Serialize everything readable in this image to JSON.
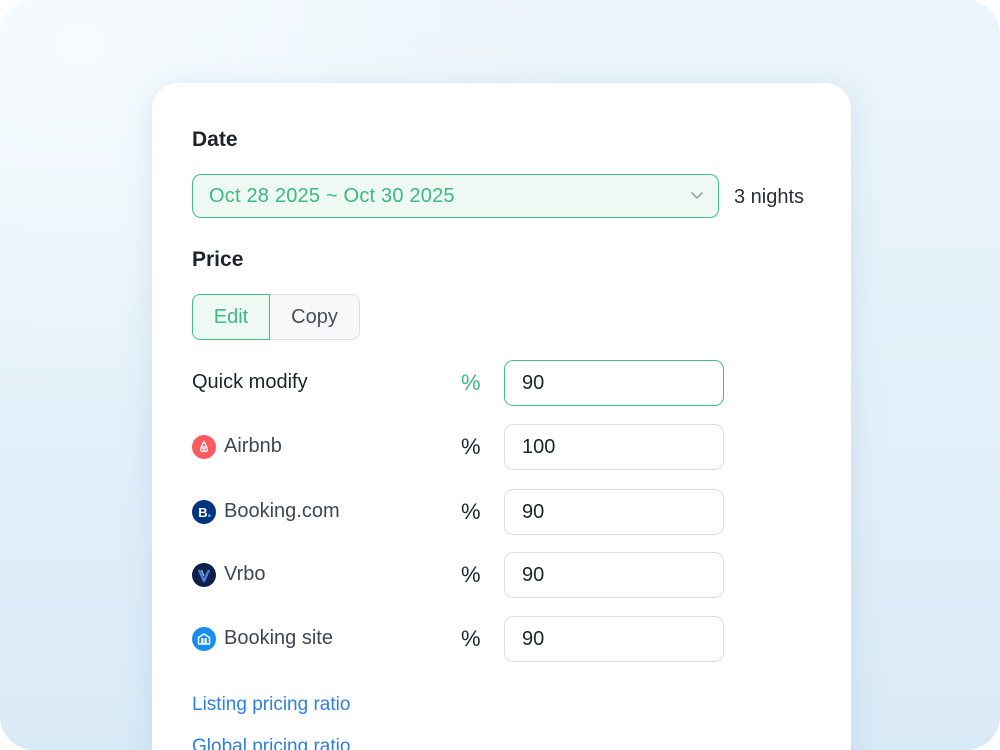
{
  "date": {
    "title": "Date",
    "range": "Oct 28 2025 ~ Oct 30 2025",
    "nights": "3 nights"
  },
  "price": {
    "title": "Price",
    "tabs": {
      "edit": "Edit",
      "copy": "Copy"
    },
    "quick_modify": {
      "label": "Quick modify",
      "unit": "%",
      "value": "90"
    },
    "channels": [
      {
        "name": "Airbnb",
        "unit": "%",
        "value": "100",
        "icon": "airbnb-logo-icon",
        "color": "#ff5a5f"
      },
      {
        "name": "Booking.com",
        "unit": "%",
        "value": "90",
        "icon": "booking-com-logo-icon",
        "color": "#003580"
      },
      {
        "name": "Vrbo",
        "unit": "%",
        "value": "90",
        "icon": "vrbo-logo-icon",
        "color": "#0e214b"
      },
      {
        "name": "Booking site",
        "unit": "%",
        "value": "90",
        "icon": "booking-site-logo-icon",
        "color": "#1a8cf0"
      }
    ]
  },
  "links": {
    "listing_ratio": "Listing pricing ratio",
    "global_ratio": "Global pricing ratio"
  },
  "colors": {
    "accent": "#3cb985",
    "link": "#2f7fe0"
  }
}
